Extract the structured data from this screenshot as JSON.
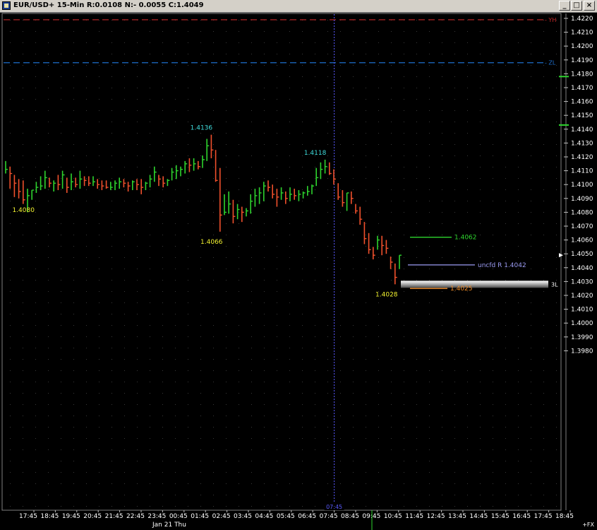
{
  "window": {
    "title": "EUR/USD+ 15-Min R:0.0108 N:- 0.0055 C:1.4049",
    "minimize_glyph": "_",
    "maximize_glyph": "□",
    "close_glyph": "×"
  },
  "colors": {
    "background": "#000000",
    "up_bar": "#2ed42e",
    "down_bar": "#f0502c",
    "high_label": "#3fdcdc",
    "low_label": "#f2f230",
    "axis_text": "#ffffff",
    "yh_line": "#c82828",
    "zl_line": "#1e6ecc",
    "crosshair": "#5a5aff",
    "level_green": "#2ed42e",
    "level_lavender": "#9b9bf2",
    "level_orange": "#f08c28"
  },
  "chart_data": {
    "type": "bar",
    "subtype": "ohlc-price-bars",
    "symbol": "EUR/USD+",
    "interval": "15-Min",
    "ylim": [
      1.3978,
      1.4232
    ],
    "y_ticks": [
      1.422,
      1.421,
      1.42,
      1.419,
      1.418,
      1.417,
      1.416,
      1.415,
      1.414,
      1.413,
      1.412,
      1.411,
      1.41,
      1.409,
      1.408,
      1.407,
      1.406,
      1.405,
      1.404,
      1.403,
      1.402,
      1.401,
      1.4,
      1.399,
      1.398
    ],
    "x_ticks": [
      "17:45",
      "18:45",
      "19:45",
      "20:45",
      "21:45",
      "22:45",
      "23:45",
      "00:45",
      "01:45",
      "02:45",
      "03:45",
      "04:45",
      "05:45",
      "06:45",
      "07:45",
      "08:45",
      "09:45",
      "10:45",
      "11:45",
      "12:45",
      "13:45",
      "14:45",
      "15:45",
      "16:45",
      "17:45",
      "18:45"
    ],
    "date_label": "Jan 21 Thu",
    "crosshair_label": "07:45",
    "axis_corner_label": "+FX",
    "bars_hlc": [
      [
        1.4117,
        1.4108,
        1.4111
      ],
      [
        1.4113,
        1.4097,
        1.4108
      ],
      [
        1.4107,
        1.4091,
        1.4101
      ],
      [
        1.4104,
        1.409,
        1.4095
      ],
      [
        1.4103,
        1.4086,
        1.4089
      ],
      [
        1.4097,
        1.408,
        1.4092
      ],
      [
        1.4096,
        1.4089,
        1.4096
      ],
      [
        1.4102,
        1.4094,
        1.4098
      ],
      [
        1.4106,
        1.4096,
        1.4099
      ],
      [
        1.411,
        1.4097,
        1.4105
      ],
      [
        1.4105,
        1.4098,
        1.4101
      ],
      [
        1.4103,
        1.4095,
        1.4101
      ],
      [
        1.4107,
        1.4096,
        1.41
      ],
      [
        1.411,
        1.4097,
        1.4107
      ],
      [
        1.4105,
        1.4094,
        1.4098
      ],
      [
        1.4108,
        1.4096,
        1.4102
      ],
      [
        1.4105,
        1.4098,
        1.41
      ],
      [
        1.411,
        1.4097,
        1.4104
      ],
      [
        1.4106,
        1.4099,
        1.4103
      ],
      [
        1.4106,
        1.4099,
        1.4101
      ],
      [
        1.4106,
        1.4099,
        1.4102
      ],
      [
        1.4104,
        1.4097,
        1.41
      ],
      [
        1.4103,
        1.4096,
        1.4099
      ],
      [
        1.4103,
        1.4097,
        1.4098
      ],
      [
        1.4102,
        1.4096,
        1.4098
      ],
      [
        1.4103,
        1.4096,
        1.4101
      ],
      [
        1.4105,
        1.4097,
        1.4102
      ],
      [
        1.4104,
        1.4098,
        1.4101
      ],
      [
        1.4102,
        1.4095,
        1.4099
      ],
      [
        1.4103,
        1.4096,
        1.4102
      ],
      [
        1.4104,
        1.4096,
        1.41
      ],
      [
        1.4104,
        1.4093,
        1.4098
      ],
      [
        1.4102,
        1.4096,
        1.4101
      ],
      [
        1.4107,
        1.4098,
        1.4104
      ],
      [
        1.4113,
        1.4102,
        1.4109
      ],
      [
        1.4107,
        1.4099,
        1.4104
      ],
      [
        1.4106,
        1.4098,
        1.4101
      ],
      [
        1.4104,
        1.4099,
        1.4103
      ],
      [
        1.4112,
        1.4103,
        1.4109
      ],
      [
        1.4114,
        1.4104,
        1.411
      ],
      [
        1.4113,
        1.4106,
        1.4111
      ],
      [
        1.4117,
        1.4108,
        1.4115
      ],
      [
        1.4119,
        1.4109,
        1.4114
      ],
      [
        1.4119,
        1.411,
        1.4115
      ],
      [
        1.4117,
        1.4111,
        1.4113
      ],
      [
        1.4121,
        1.4112,
        1.4118
      ],
      [
        1.4133,
        1.4117,
        1.4128
      ],
      [
        1.4136,
        1.4119,
        1.4125
      ],
      [
        1.4125,
        1.4102,
        1.4103
      ],
      [
        1.4112,
        1.4066,
        1.4078
      ],
      [
        1.4093,
        1.4078,
        1.408
      ],
      [
        1.4095,
        1.4079,
        1.4086
      ],
      [
        1.4089,
        1.4072,
        1.4077
      ],
      [
        1.4086,
        1.4075,
        1.4082
      ],
      [
        1.4084,
        1.4073,
        1.408
      ],
      [
        1.4083,
        1.4077,
        1.4081
      ],
      [
        1.4093,
        1.4079,
        1.4088
      ],
      [
        1.4097,
        1.4084,
        1.4092
      ],
      [
        1.4098,
        1.4086,
        1.4094
      ],
      [
        1.4102,
        1.4088,
        1.4099
      ],
      [
        1.4103,
        1.4095,
        1.4098
      ],
      [
        1.41,
        1.409,
        1.4093
      ],
      [
        1.4097,
        1.4084,
        1.4091
      ],
      [
        1.4098,
        1.4089,
        1.4094
      ],
      [
        1.4095,
        1.4086,
        1.409
      ],
      [
        1.4098,
        1.4088,
        1.4093
      ],
      [
        1.4097,
        1.4089,
        1.4092
      ],
      [
        1.4096,
        1.4088,
        1.4093
      ],
      [
        1.4095,
        1.409,
        1.4094
      ],
      [
        1.4099,
        1.4092,
        1.4095
      ],
      [
        1.41,
        1.4093,
        1.4099
      ],
      [
        1.4112,
        1.4099,
        1.4105
      ],
      [
        1.4116,
        1.4104,
        1.4111
      ],
      [
        1.4118,
        1.4108,
        1.4113
      ],
      [
        1.4116,
        1.4107,
        1.4108
      ],
      [
        1.4111,
        1.41,
        1.4104
      ],
      [
        1.4101,
        1.4089,
        1.4091
      ],
      [
        1.4096,
        1.4084,
        1.4087
      ],
      [
        1.4094,
        1.4081,
        1.4094
      ],
      [
        1.4095,
        1.4086,
        1.409
      ],
      [
        1.4086,
        1.4079,
        1.4081
      ],
      [
        1.4084,
        1.4071,
        1.4075
      ],
      [
        1.4073,
        1.4057,
        1.4061
      ],
      [
        1.4065,
        1.405,
        1.4053
      ],
      [
        1.4055,
        1.4046,
        1.4049
      ],
      [
        1.4063,
        1.4053,
        1.406
      ],
      [
        1.4063,
        1.4049,
        1.4056
      ],
      [
        1.406,
        1.405,
        1.4054
      ],
      [
        1.4048,
        1.4039,
        1.4044
      ],
      [
        1.4043,
        1.4028,
        1.4033
      ],
      [
        1.4049,
        1.4039,
        1.4049
      ]
    ],
    "annotations": [
      {
        "text": "1.4080",
        "type": "low",
        "bar": 6
      },
      {
        "text": "1.4136",
        "type": "high",
        "bar": 47
      },
      {
        "text": "1.4066",
        "type": "low",
        "bar": 49
      },
      {
        "text": "1.4118",
        "type": "high",
        "bar": 73
      },
      {
        "text": "1.4028",
        "type": "low",
        "bar": 89
      }
    ],
    "reference_lines": [
      {
        "label": "YH",
        "value": 1.4219,
        "color": "#c82828",
        "style": "dashed"
      },
      {
        "label": "ZL",
        "value": 1.4188,
        "color": "#1e6ecc",
        "style": "dashed"
      }
    ],
    "levels": [
      {
        "value": 1.4062,
        "text": "1.4062",
        "color": "#2ed42e"
      },
      {
        "value": 1.4042,
        "text": "uncfd R 1.4042",
        "color": "#9b9bf2"
      },
      {
        "value": 1.4025,
        "text": "1.4025",
        "color": "#f08c28"
      }
    ],
    "band": {
      "value": 1.4028,
      "label": "3L"
    },
    "right_markers": [
      {
        "value": 1.4178,
        "color": "#2ed42e"
      },
      {
        "value": 1.4143,
        "color": "#2ed42e"
      },
      {
        "value": 1.4049,
        "color": "#ffffff"
      }
    ]
  }
}
